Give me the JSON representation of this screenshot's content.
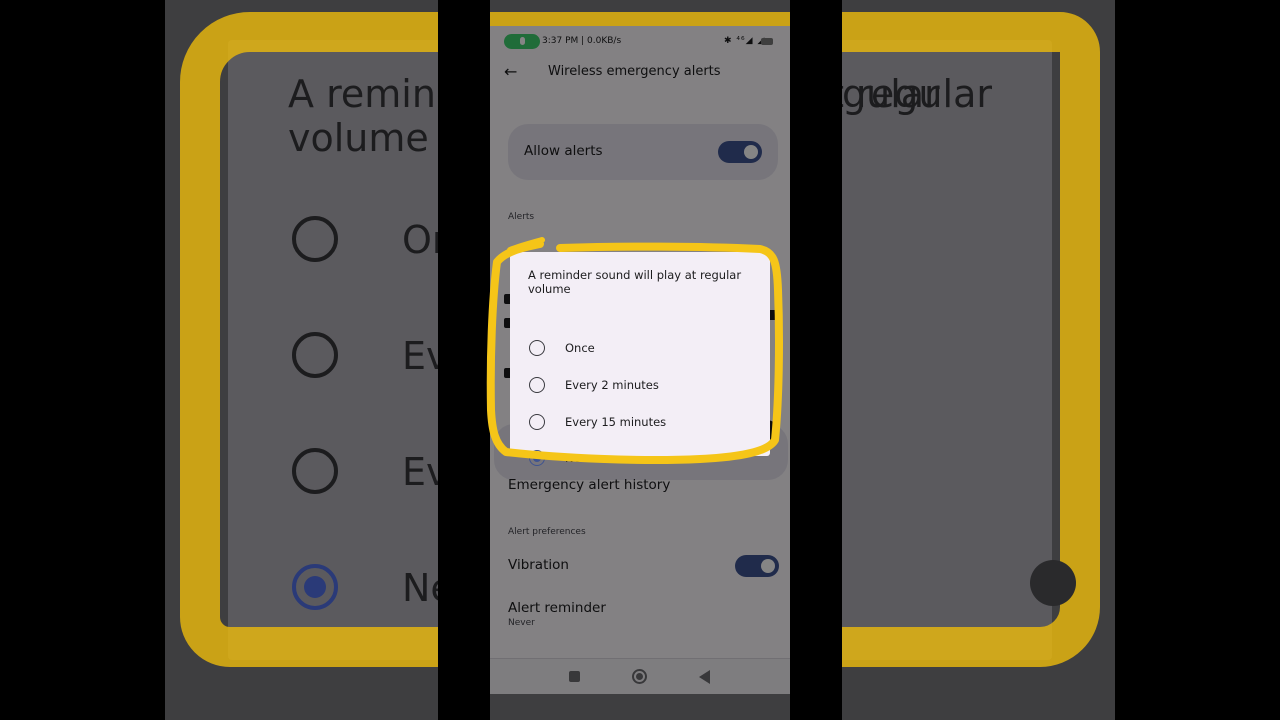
{
  "status_bar": {
    "text": "3:37 PM | 0.0KB/s",
    "icons": "✱ ⁴⁶◢ ◢"
  },
  "app_bar": {
    "title": "Wireless emergency alerts"
  },
  "settings": {
    "allow_alerts_label": "Allow alerts",
    "allow_alerts_on": true,
    "alerts_section": "Alerts",
    "history_label": "Emergency alert history",
    "preferences_section": "Alert preferences",
    "vibration_label": "Vibration",
    "vibration_on": true,
    "reminder_label": "Alert reminder",
    "reminder_value": "Never"
  },
  "dialog": {
    "title": "A reminder sound will play at regular volume",
    "options": [
      {
        "label": "Once",
        "selected": false
      },
      {
        "label": "Every 2 minutes",
        "selected": false
      },
      {
        "label": "Every 15 minutes",
        "selected": false
      },
      {
        "label": "Never",
        "selected": true
      }
    ]
  },
  "background_zoom": {
    "title_left": "A reminder sound will play at regular volume",
    "title_right": "gular",
    "options": [
      "On",
      "Ev",
      "Ev",
      "Ne"
    ]
  },
  "colors": {
    "accent": "#3f5390",
    "highlight": "#f5c518",
    "surface": "#f3eef6"
  }
}
